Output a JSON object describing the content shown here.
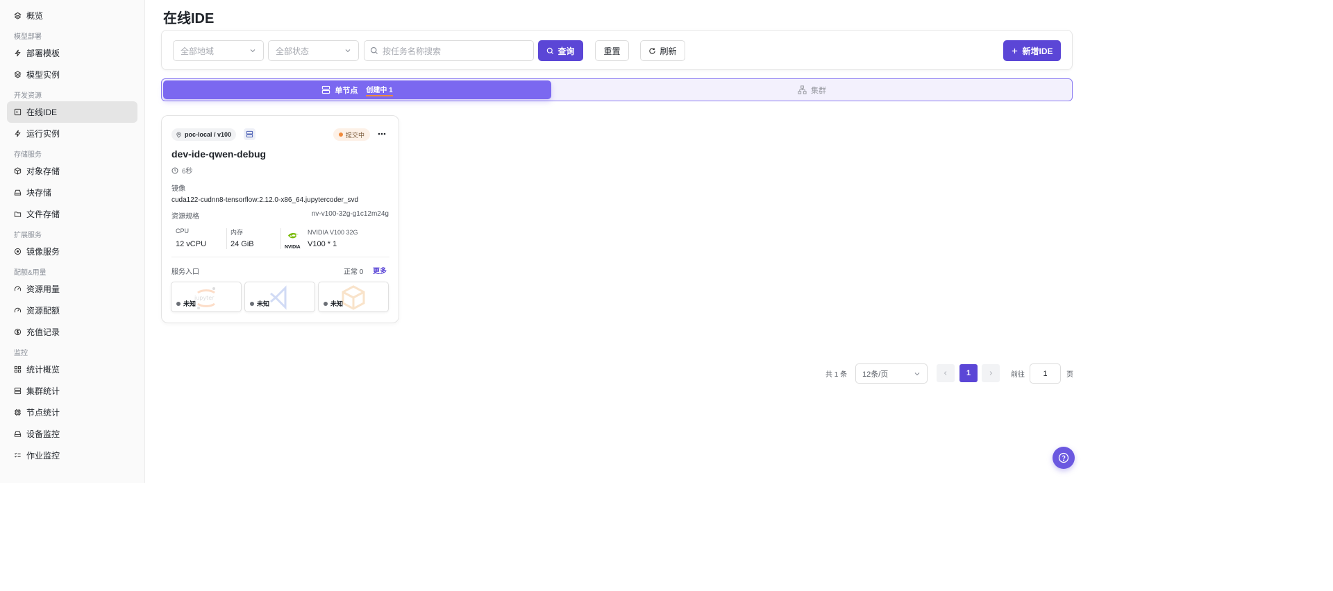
{
  "sidebar": {
    "items": [
      {
        "label": "概览",
        "icon": "layers-icon"
      },
      {
        "label": "部署模板",
        "icon": "bolt-icon"
      },
      {
        "label": "模型实例",
        "icon": "cube-icon"
      },
      {
        "label": "在线IDE",
        "icon": "ide-icon",
        "active": true
      },
      {
        "label": "运行实例",
        "icon": "bolt-icon"
      },
      {
        "label": "对象存储",
        "icon": "box-icon"
      },
      {
        "label": "块存储",
        "icon": "drive-icon"
      },
      {
        "label": "文件存储",
        "icon": "folder-icon"
      },
      {
        "label": "镜像服务",
        "icon": "disc-icon"
      },
      {
        "label": "资源用量",
        "icon": "gauge-icon"
      },
      {
        "label": "资源配额",
        "icon": "gauge-icon"
      },
      {
        "label": "充值记录",
        "icon": "dollar-icon"
      },
      {
        "label": "统计概览",
        "icon": "grid-icon"
      },
      {
        "label": "集群统计",
        "icon": "server-icon"
      },
      {
        "label": "节点统计",
        "icon": "chip-icon"
      },
      {
        "label": "设备监控",
        "icon": "drive-icon"
      },
      {
        "label": "作业监控",
        "icon": "checklist-icon"
      }
    ],
    "sections": {
      "model_deploy": "模型部署",
      "dev_resources": "开发资源",
      "storage": "存储服务",
      "extension": "扩展服务",
      "quota": "配额&用量",
      "monitor": "监控"
    }
  },
  "page": {
    "title": "在线IDE"
  },
  "filters": {
    "region_placeholder": "全部地域",
    "status_placeholder": "全部状态",
    "search_placeholder": "按任务名称搜索",
    "query_label": "查询",
    "reset_label": "重置",
    "refresh_label": "刷新",
    "new_label": "新增IDE"
  },
  "segment": {
    "single_label": "单节点",
    "single_badge": "创建中 1",
    "cluster_label": "集群"
  },
  "card": {
    "location": "poc-local / v100",
    "status": "提交中",
    "title": "dev-ide-qwen-debug",
    "duration": "6秒",
    "image_label": "镜像",
    "image_value": "cuda122-cudnn8-tensorflow:2.12.0-x86_64.jupytercoder_svd",
    "spec_label": "资源规格",
    "spec_value": "nv-v100-32g-g1c12m24g",
    "cpu_label": "CPU",
    "cpu_value": "12 vCPU",
    "mem_label": "内存",
    "mem_value": "24 GiB",
    "gpu_brand": "NVIDIA",
    "gpu_name": "NVIDIA V100 32G",
    "gpu_value": "V100 * 1",
    "service_label": "服务入口",
    "service_normal": "正常 0",
    "service_more": "更多",
    "services": [
      {
        "status": "未知",
        "icon": "jupyter-icon",
        "watermark": "jupyter"
      },
      {
        "status": "未知",
        "icon": "vscode-icon"
      },
      {
        "status": "未知",
        "icon": "box3d-icon"
      }
    ]
  },
  "pagination": {
    "total": "共 1 条",
    "page_size": "12条/页",
    "current_page": "1",
    "goto_label": "前往",
    "goto_value": "1",
    "unit": "页"
  },
  "colors": {
    "primary": "#5b46d6",
    "segment_active": "#7b68f0",
    "status_orange": "#f08a3c",
    "nvidia_green": "#76b900"
  }
}
